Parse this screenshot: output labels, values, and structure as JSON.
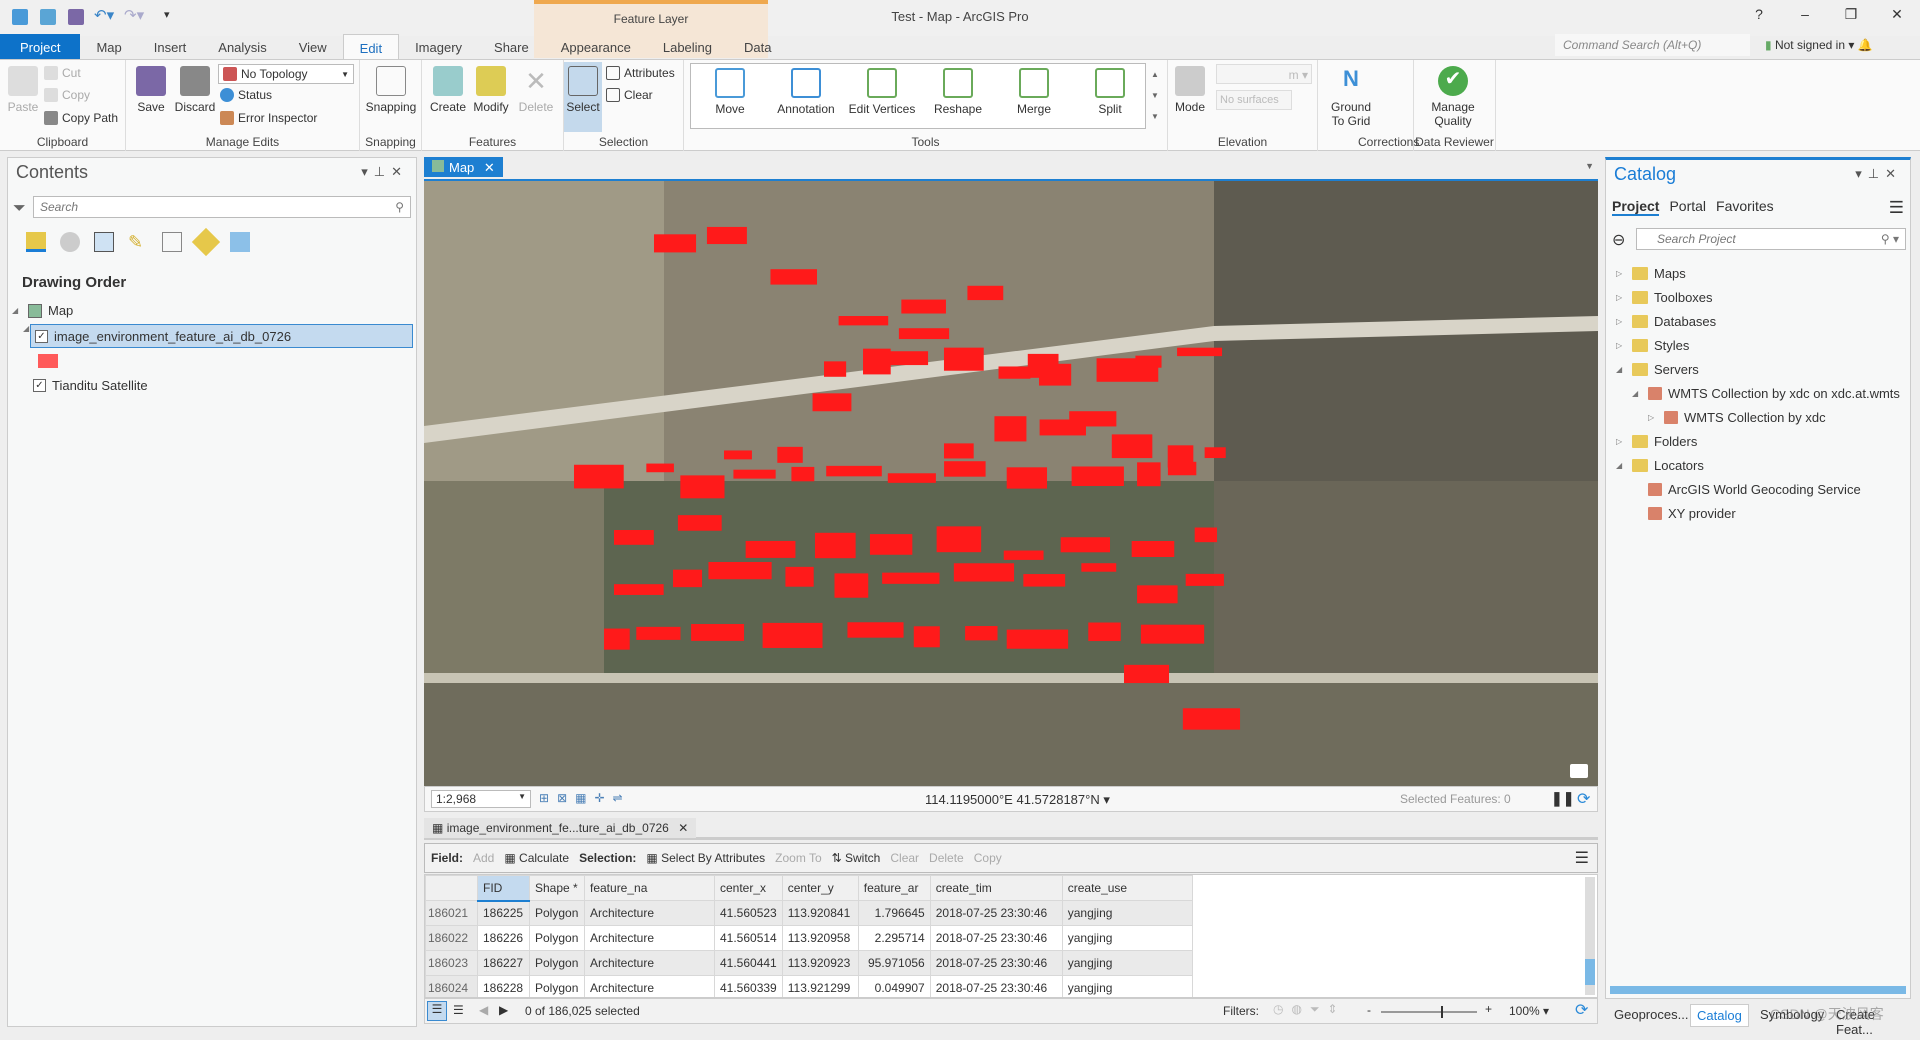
{
  "window": {
    "title": "Test - Map - ArcGIS Pro",
    "context_tab": "Feature Layer",
    "help": "?",
    "minimize": "–",
    "restore": "❐",
    "close": "✕"
  },
  "tabs": [
    "Project",
    "Map",
    "Insert",
    "Analysis",
    "View",
    "Edit",
    "Imagery",
    "Share",
    "Appearance",
    "Labeling",
    "Data"
  ],
  "active_tab": "Edit",
  "command_search": {
    "placeholder": "Command Search (Alt+Q)"
  },
  "account": {
    "label": "Not signed in ▾"
  },
  "ribbon": {
    "clipboard": {
      "label": "Clipboard",
      "paste": "Paste",
      "cut": "Cut",
      "copy": "Copy",
      "copy_path": "Copy Path"
    },
    "manage_edits": {
      "label": "Manage Edits",
      "save": "Save",
      "discard": "Discard",
      "topology": "No Topology",
      "status": "Status",
      "error_inspector": "Error Inspector"
    },
    "snapping": {
      "label": "Snapping",
      "snapping": "Snapping"
    },
    "features": {
      "label": "Features",
      "create": "Create",
      "modify": "Modify",
      "delete": "Delete"
    },
    "selection": {
      "label": "Selection",
      "select": "Select",
      "attributes": "Attributes",
      "clear": "Clear"
    },
    "tools": {
      "label": "Tools",
      "items": [
        "Move",
        "Annotation",
        "Edit Vertices",
        "Reshape",
        "Merge",
        "Split"
      ]
    },
    "elevation": {
      "label": "Elevation",
      "mode": "Mode",
      "unit": "m",
      "surfaces": "No surfaces"
    },
    "corrections": {
      "label": "Corrections",
      "ground_to_grid": "Ground To Grid"
    },
    "data_reviewer": {
      "label": "Data Reviewer",
      "manage_quality": "Manage Quality"
    }
  },
  "contents": {
    "title": "Contents",
    "search_placeholder": "Search",
    "heading": "Drawing Order",
    "map": "Map",
    "layers": [
      {
        "name": "image_environment_feature_ai_db_0726",
        "checked": true,
        "selected": true,
        "symbol_color": "#ff5a5a"
      },
      {
        "name": "Tianditu Satellite",
        "checked": true
      }
    ]
  },
  "map_view": {
    "tab": "Map",
    "scale": "1:2,968",
    "coordinates": "114.1195000°E 41.5728187°N",
    "selected_features": "Selected Features: 0",
    "feature_color": "#ff1a1a"
  },
  "attribute_table": {
    "tab": "image_environment_fe...ture_ai_db_0726",
    "field_label": "Field:",
    "add": "Add",
    "calculate": "Calculate",
    "selection_label": "Selection:",
    "select_by_attributes": "Select By Attributes",
    "zoom_to": "Zoom To",
    "switch": "Switch",
    "clear": "Clear",
    "delete": "Delete",
    "copy": "Copy",
    "columns": [
      "FID",
      "Shape *",
      "feature_na",
      "center_x",
      "center_y",
      "feature_ar",
      "create_tim",
      "create_use"
    ],
    "rows": [
      {
        "row": "186021",
        "cells": [
          "186225",
          "Polygon",
          "Architecture",
          "41.560523",
          "113.920841",
          "1.796645",
          "2018-07-25 23:30:46",
          "yangjing"
        ]
      },
      {
        "row": "186022",
        "cells": [
          "186226",
          "Polygon",
          "Architecture",
          "41.560514",
          "113.920958",
          "2.295714",
          "2018-07-25 23:30:46",
          "yangjing"
        ]
      },
      {
        "row": "186023",
        "cells": [
          "186227",
          "Polygon",
          "Architecture",
          "41.560441",
          "113.920923",
          "95.971056",
          "2018-07-25 23:30:46",
          "yangjing"
        ]
      },
      {
        "row": "186024",
        "cells": [
          "186228",
          "Polygon",
          "Architecture",
          "41.560339",
          "113.921299",
          "0.049907",
          "2018-07-25 23:30:46",
          "yangjing"
        ]
      }
    ],
    "selected_count": "0 of 186,025 selected",
    "filters": "Filters:",
    "zoom": "100%"
  },
  "catalog": {
    "title": "Catalog",
    "tabs": [
      "Project",
      "Portal",
      "Favorites"
    ],
    "search_placeholder": "Search Project",
    "items": [
      {
        "label": "Maps",
        "level": 0,
        "expander": "▷"
      },
      {
        "label": "Toolboxes",
        "level": 0,
        "expander": "▷"
      },
      {
        "label": "Databases",
        "level": 0,
        "expander": "▷"
      },
      {
        "label": "Styles",
        "level": 0,
        "expander": "▷"
      },
      {
        "label": "Servers",
        "level": 0,
        "expander": "◢"
      },
      {
        "label": "WMTS Collection by xdc on xdc.at.wmts",
        "level": 1,
        "expander": "◢"
      },
      {
        "label": "WMTS Collection by xdc",
        "level": 2,
        "expander": "▷"
      },
      {
        "label": "Folders",
        "level": 0,
        "expander": "▷"
      },
      {
        "label": "Locators",
        "level": 0,
        "expander": "◢"
      },
      {
        "label": "ArcGIS World Geocoding Service",
        "level": 1,
        "expander": ""
      },
      {
        "label": "XY provider",
        "level": 1,
        "expander": ""
      }
    ]
  },
  "bottom_tabs": [
    "Geoproces...",
    "Catalog",
    "Symbology",
    "Create Feat..."
  ],
  "active_bottom_tab": "Catalog",
  "watermark": "CSDN @天波风客",
  "colors": {
    "accent": "#0d72c9",
    "context": "#efa84e"
  }
}
